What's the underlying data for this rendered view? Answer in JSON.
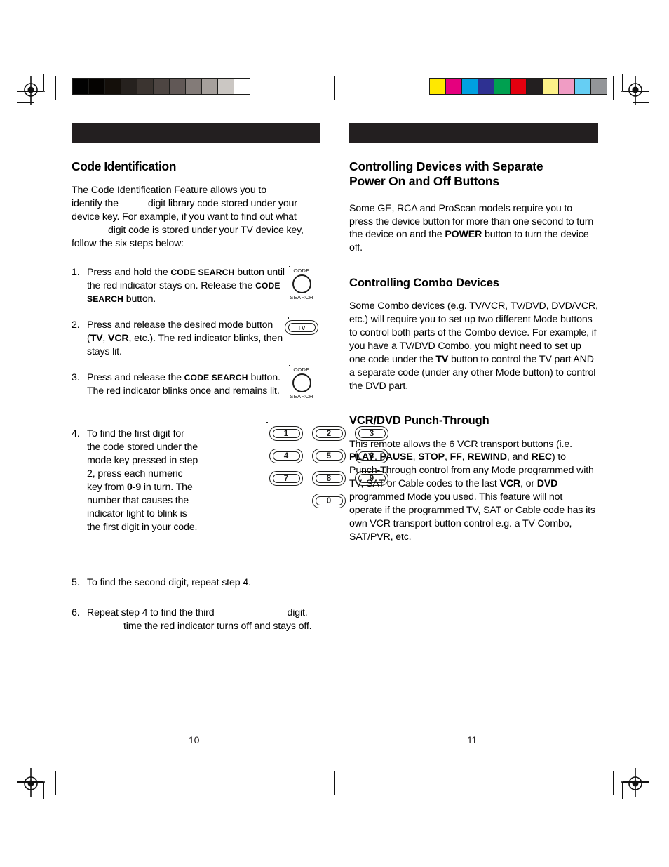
{
  "document": {
    "left_page_number": "10",
    "right_page_number": "11"
  },
  "print_marks": {
    "registration_icon": "registration-target-icon",
    "grayscale_bar": {
      "name": "grayscale-step-wedge",
      "patches": [
        "#020202",
        "#050301",
        "#140f0a",
        "#26211e",
        "#3b3430",
        "#4d4542",
        "#615856",
        "#837b78",
        "#a6a09c",
        "#cbc7c3",
        "#ffffff"
      ]
    },
    "color_bar": {
      "name": "process-color-bar",
      "patches": [
        "#ffe800",
        "#e5007e",
        "#00a0e0",
        "#2e3192",
        "#00a050",
        "#e3000f",
        "#231f20",
        "#fdf189",
        "#f09cc4",
        "#66cef3",
        "#939598"
      ]
    }
  },
  "left_column": {
    "heading": "Code Identification",
    "intro": {
      "line1": "The Code Identification Feature allows you to",
      "line2_a": "identify the",
      "line2_b": "digit library code stored under your",
      "line3": "device key. For example, if you want to find out what",
      "line4_a": "digit code is stored under your TV device key,",
      "line5": "follow the six steps below:"
    },
    "steps": [
      {
        "number": "1.",
        "text_a": "Press and hold the ",
        "caps_a": "CODE SEARCH",
        "text_b": " button until the red indicator stays on. Release the ",
        "caps_b": "CODE SEARCH",
        "text_c": " button.",
        "art": "code-search-button"
      },
      {
        "number": "2.",
        "text_a": "Press and release the desired mode button (",
        "bold_a": "TV",
        "text_b": ", ",
        "bold_b": "VCR",
        "text_c": ", etc.). The red indicator blinks, then stays lit.",
        "art": "tv-mode-button"
      },
      {
        "number": "3.",
        "text_a": "Press and release the ",
        "caps_a": "CODE SEARCH",
        "text_b": " button. The red indicator blinks once and remains lit.",
        "art": "code-search-button"
      },
      {
        "number": "4.",
        "text_a": "To find the first digit for the code stored under the mode key pressed in step 2, press each numeric key from ",
        "bold_a": "0-9",
        "text_b": " in turn. The number that causes the indicator light to blink is the first digit in your code.",
        "art": "numeric-keypad"
      },
      {
        "number": "5.",
        "text_a": "To find the second digit, repeat step 4.",
        "art": ""
      },
      {
        "number": "6.",
        "text_a": "Repeat step 4 to find the third",
        "text_b": "digit.",
        "text_c": "time the red indicator turns off and stays off.",
        "art": ""
      }
    ],
    "buttons": {
      "code_search_top": "CODE",
      "code_search_bottom": "SEARCH",
      "tv_label": "TV"
    },
    "keypad_keys": [
      "1",
      "2",
      "3",
      "4",
      "5",
      "6",
      "7",
      "8",
      "9",
      "0"
    ]
  },
  "right_column": {
    "section1": {
      "heading_line1": "Controlling Devices with Separate",
      "heading_line2": "Power On and Off Buttons",
      "body_a": "Some GE, RCA and ProScan models require you to press the device button for more than one second to turn the device on and the ",
      "body_bold": "POWER",
      "body_b": " button to turn the device off."
    },
    "section2": {
      "heading": "Controlling Combo Devices",
      "body_a": "Some Combo devices (e.g. TV/VCR, TV/DVD, DVD/VCR, etc.) will require you to set up two different Mode buttons to control both parts of the Combo device. For example, if you have a TV/DVD Combo, you might need to set up one code under the ",
      "body_bold": "TV",
      "body_b": " button to control the TV part AND a separate code (under any other Mode button) to control the DVD part."
    },
    "section3": {
      "heading": "VCR/DVD  Punch-Through",
      "body_a": "This remote allows the 6 VCR transport buttons (i.e. ",
      "bold_play": "PLAY",
      "sep1": ", ",
      "bold_pause": "PAUSE",
      "sep2": ", ",
      "bold_stop": "STOP",
      "sep3": ", ",
      "bold_ff": "FF",
      "sep4": ", ",
      "bold_rewind": "REWIND",
      "sep5": ", and ",
      "bold_rec": "REC",
      "body_b": ") to Punch-Through control from any Mode programmed with TV, SAT or Cable codes to the last ",
      "bold_vcr": "VCR",
      "sep6": ", or ",
      "bold_dvd": "DVD",
      "body_c": " programmed Mode you used. This feature will not operate if the programmed TV, SAT or Cable code has its own VCR transport button control e.g. a TV Combo, SAT/PVR, etc."
    }
  }
}
